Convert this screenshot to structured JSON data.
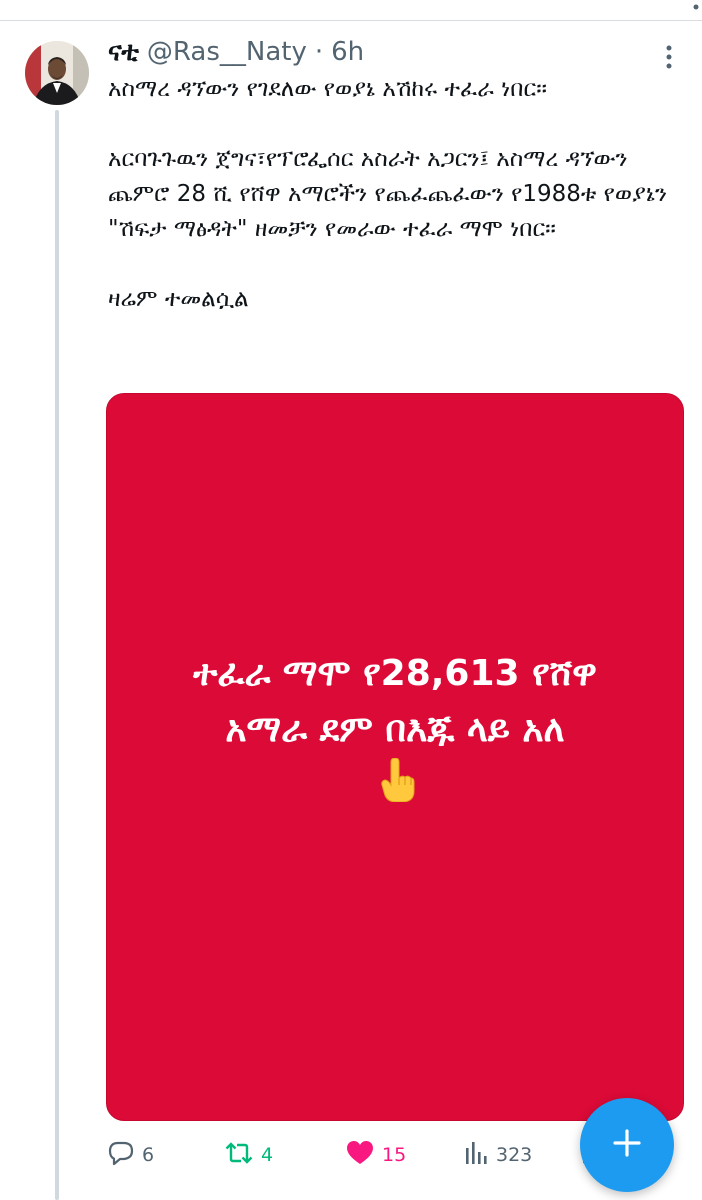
{
  "tweet": {
    "display_name": "ናቲ",
    "handle": "@Ras__Naty",
    "separator": "·",
    "time": "6h",
    "paragraphs": [
      "አስማረ ዳኘውን የገደለው የወያኔ አሽከሩ ተፈራ ነበር።",
      "አርባጉጉዉን ጀግና፣የፕሮፌሰር አስራት አጋርን፤ አስማረ ዳኘውን ጨምሮ 28 ሺ የሸዋ አማሮችን የጨፈጨፈውን የ1988ቱ የወያኔን \"ሽፍታ ማፅዳት\" ዘመቻን የመራው ተፈራ ማሞ ነበር።",
      "ዛሬም ተመልሷል"
    ],
    "media": {
      "line1": "ተፈራ ማሞ የ28,613 የሸዋ",
      "line2": "አማራ ደም በእጁ ላይ አለ",
      "emoji": "☝",
      "background": "#dc0a37"
    },
    "actions": {
      "replies": "6",
      "retweets": "4",
      "likes": "15",
      "views": "323"
    }
  },
  "colors": {
    "accent": "#1d9bf0",
    "retweet": "#00ba7c",
    "like": "#f91880",
    "muted": "#536471"
  },
  "icons": [
    "more-icon",
    "reply-icon",
    "retweet-icon",
    "heart-icon",
    "views-icon",
    "share-icon",
    "plus-icon",
    "pointing-up-emoji"
  ]
}
